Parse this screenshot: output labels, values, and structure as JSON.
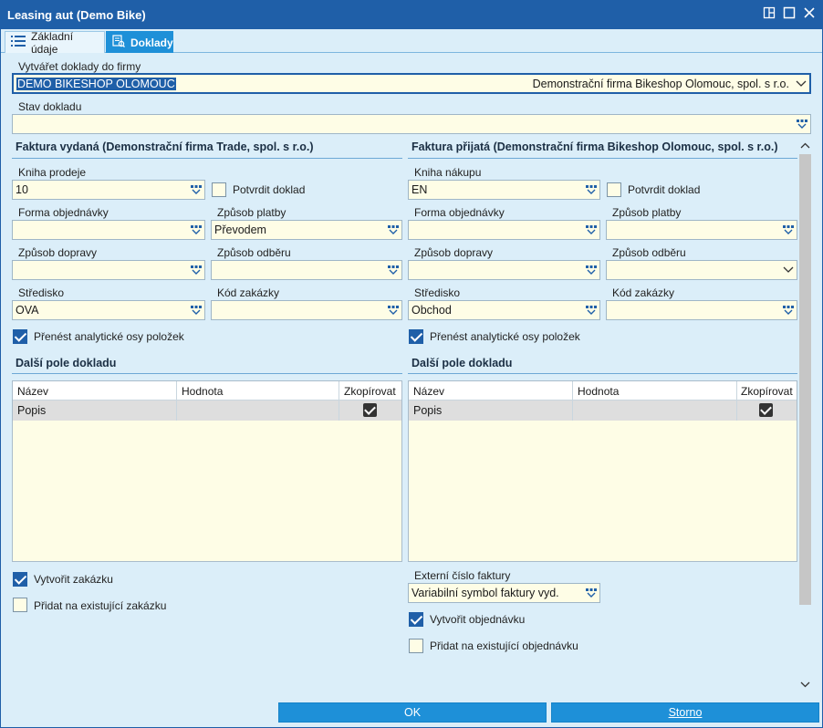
{
  "window": {
    "title": "Leasing aut (Demo Bike)"
  },
  "tabs": [
    {
      "label": "Základní údaje",
      "icon": "list-icon"
    },
    {
      "label": "Doklady",
      "icon": "documents-icon",
      "active": true
    }
  ],
  "firm": {
    "label": "Vytvářet doklady do firmy",
    "code": "DEMO BIKESHOP OLOMOUC",
    "name": "Demonstrační firma Bikeshop Olomouc, spol. s r.o."
  },
  "stav": {
    "label": "Stav dokladu",
    "value": ""
  },
  "left": {
    "title": "Faktura vydaná (Demonstrační firma Trade, spol. s r.o.)",
    "kniha_label": "Kniha prodeje",
    "kniha_value": "10",
    "potvrdit_label": "Potvrdit doklad",
    "potvrdit_checked": false,
    "forma_label": "Forma objednávky",
    "forma_value": "",
    "platba_label": "Způsob platby",
    "platba_value": "Převodem",
    "doprava_label": "Způsob dopravy",
    "doprava_value": "",
    "odber_label": "Způsob odběru",
    "odber_value": "",
    "stredisko_label": "Středisko",
    "stredisko_value": "OVA",
    "zakazka_label": "Kód zakázky",
    "zakazka_value": "",
    "prenest_label": "Přenést analytické osy položek",
    "prenest_checked": true,
    "dalsi_title": "Další pole dokladu",
    "grid": {
      "col_name": "Název",
      "col_value": "Hodnota",
      "col_copy": "Zkopírovat",
      "rows": [
        {
          "name": "Popis",
          "value": "",
          "copy": true
        }
      ]
    },
    "vytvorit_label": "Vytvořit zakázku",
    "vytvorit_checked": true,
    "pridat_label": "Přidat na existující zakázku",
    "pridat_checked": false
  },
  "right": {
    "title": "Faktura přijatá (Demonstrační firma Bikeshop Olomouc, spol. s r.o.)",
    "kniha_label": "Kniha nákupu",
    "kniha_value": "EN",
    "potvrdit_label": "Potvrdit doklad",
    "potvrdit_checked": false,
    "forma_label": "Forma objednávky",
    "forma_value": "",
    "platba_label": "Způsob platby",
    "platba_value": "",
    "doprava_label": "Způsob dopravy",
    "doprava_value": "",
    "odber_label": "Způsob odběru",
    "odber_value": "",
    "stredisko_label": "Středisko",
    "stredisko_value": "Obchod",
    "zakazka_label": "Kód zakázky",
    "zakazka_value": "",
    "prenest_label": "Přenést analytické osy položek",
    "prenest_checked": true,
    "dalsi_title": "Další pole dokladu",
    "grid": {
      "col_name": "Název",
      "col_value": "Hodnota",
      "col_copy": "Zkopírovat",
      "rows": [
        {
          "name": "Popis",
          "value": "",
          "copy": true
        }
      ]
    },
    "externi_label": "Externí číslo faktury",
    "externi_value": "Variabilní symbol faktury vyd.",
    "vytvorit_label": "Vytvořit objednávku",
    "vytvorit_checked": true,
    "pridat_label": "Přidat na existující objednávku",
    "pridat_checked": false
  },
  "footer": {
    "ok_label": "OK",
    "storno_label": "Storno"
  },
  "colors": {
    "accent": "#1e90d8",
    "titlebar": "#1f5fa8",
    "background": "#dbeef9",
    "field": "#fefde6"
  }
}
